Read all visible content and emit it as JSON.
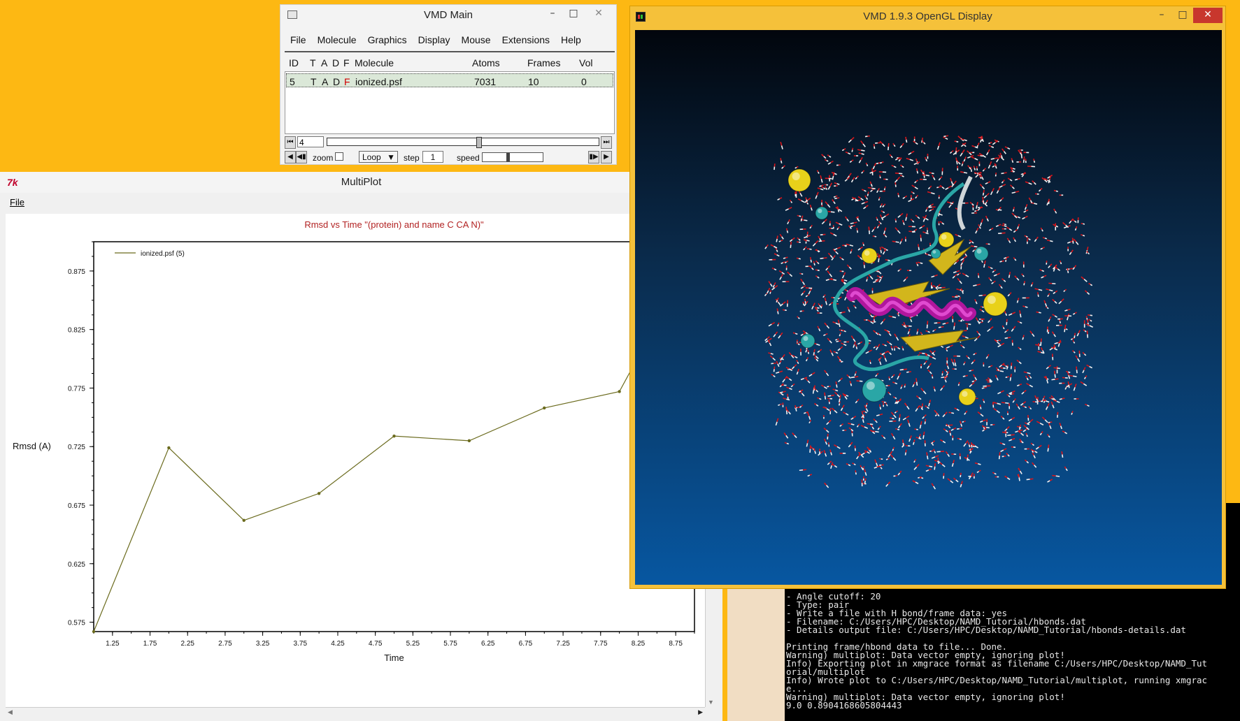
{
  "vmd_main": {
    "title": "VMD Main",
    "menu": [
      "File",
      "Molecule",
      "Graphics",
      "Display",
      "Mouse",
      "Extensions",
      "Help"
    ],
    "columns": [
      "ID",
      "T",
      "A",
      "D",
      "F",
      "Molecule",
      "Atoms",
      "Frames",
      "Vol"
    ],
    "row": {
      "id": "5",
      "t": "T",
      "a": "A",
      "d": "D",
      "f": "F",
      "molecule": "ionized.psf",
      "atoms": "7031",
      "frames": "10",
      "vol": "0"
    },
    "frame_value": "4",
    "zoom_label": "zoom",
    "loop_value": "Loop",
    "step_label": "step",
    "step_value": "1",
    "speed_label": "speed",
    "frame_slider_level": 0.55,
    "speed_slider_level": 0.4
  },
  "multiplot": {
    "title": "MultiPlot",
    "tk_icon": "tk-feather-icon",
    "menu_file": "File"
  },
  "chart_data": {
    "type": "line",
    "title": "Rmsd vs Time \"(protein) and name C CA N)\"",
    "xlabel": "Time",
    "ylabel": "Rmsd (A)",
    "xlim": [
      1.0,
      9.0
    ],
    "ylim": [
      0.567,
      0.9
    ],
    "xticks": [
      "1.25",
      "1.75",
      "2.25",
      "2.75",
      "3.25",
      "3.75",
      "4.25",
      "4.75",
      "5.25",
      "5.75",
      "6.25",
      "6.75",
      "7.25",
      "7.75",
      "8.25",
      "8.75"
    ],
    "yticks": [
      "0.575",
      "0.625",
      "0.675",
      "0.725",
      "0.775",
      "0.825",
      "0.875"
    ],
    "legend_position": "top-left",
    "series": [
      {
        "name": "ionized.psf (5)",
        "color": "#6b6b1e",
        "x": [
          1,
          2,
          3,
          4,
          5,
          6,
          7,
          8,
          9
        ],
        "y": [
          0.567,
          0.724,
          0.662,
          0.685,
          0.734,
          0.73,
          0.758,
          0.772,
          0.89
        ]
      }
    ]
  },
  "console": {
    "lines": [
      "- Angle cutoff: 20",
      "- Type: pair",
      "- Write a file with H bond/frame data: yes",
      "- Filename: C:/Users/HPC/Desktop/NAMD_Tutorial/hbonds.dat",
      "- Details output file: C:/Users/HPC/Desktop/NAMD_Tutorial/hbonds-details.dat",
      "",
      "Printing frame/hbond data to file... Done.",
      "Warning) multiplot: Data vector empty, ignoring plot!",
      "Info) Exporting plot in xmgrace format as filename C:/Users/HPC/Desktop/NAMD_Tut",
      "orial/multiplot",
      "Info) Wrote plot to C:/Users/HPC/Desktop/NAMD_Tutorial/multiplot, running xmgrac",
      "e...",
      "Warning) multiplot: Data vector empty, ignoring plot!",
      "9.0 0.8904168605804443"
    ]
  },
  "gl_display": {
    "title": "VMD 1.9.3 OpenGL Display",
    "icon": "vmd-app-icon"
  },
  "colors": {
    "desktop": "#FDB813",
    "plot_line": "#6b6b1e",
    "plot_title": "#b22222",
    "gl_frame": "#F5C13A",
    "ion_yellow": "#e8d11a",
    "ion_cyan": "#2aa6a6",
    "helix": "#b0169d",
    "sheet": "#d2b61c"
  }
}
